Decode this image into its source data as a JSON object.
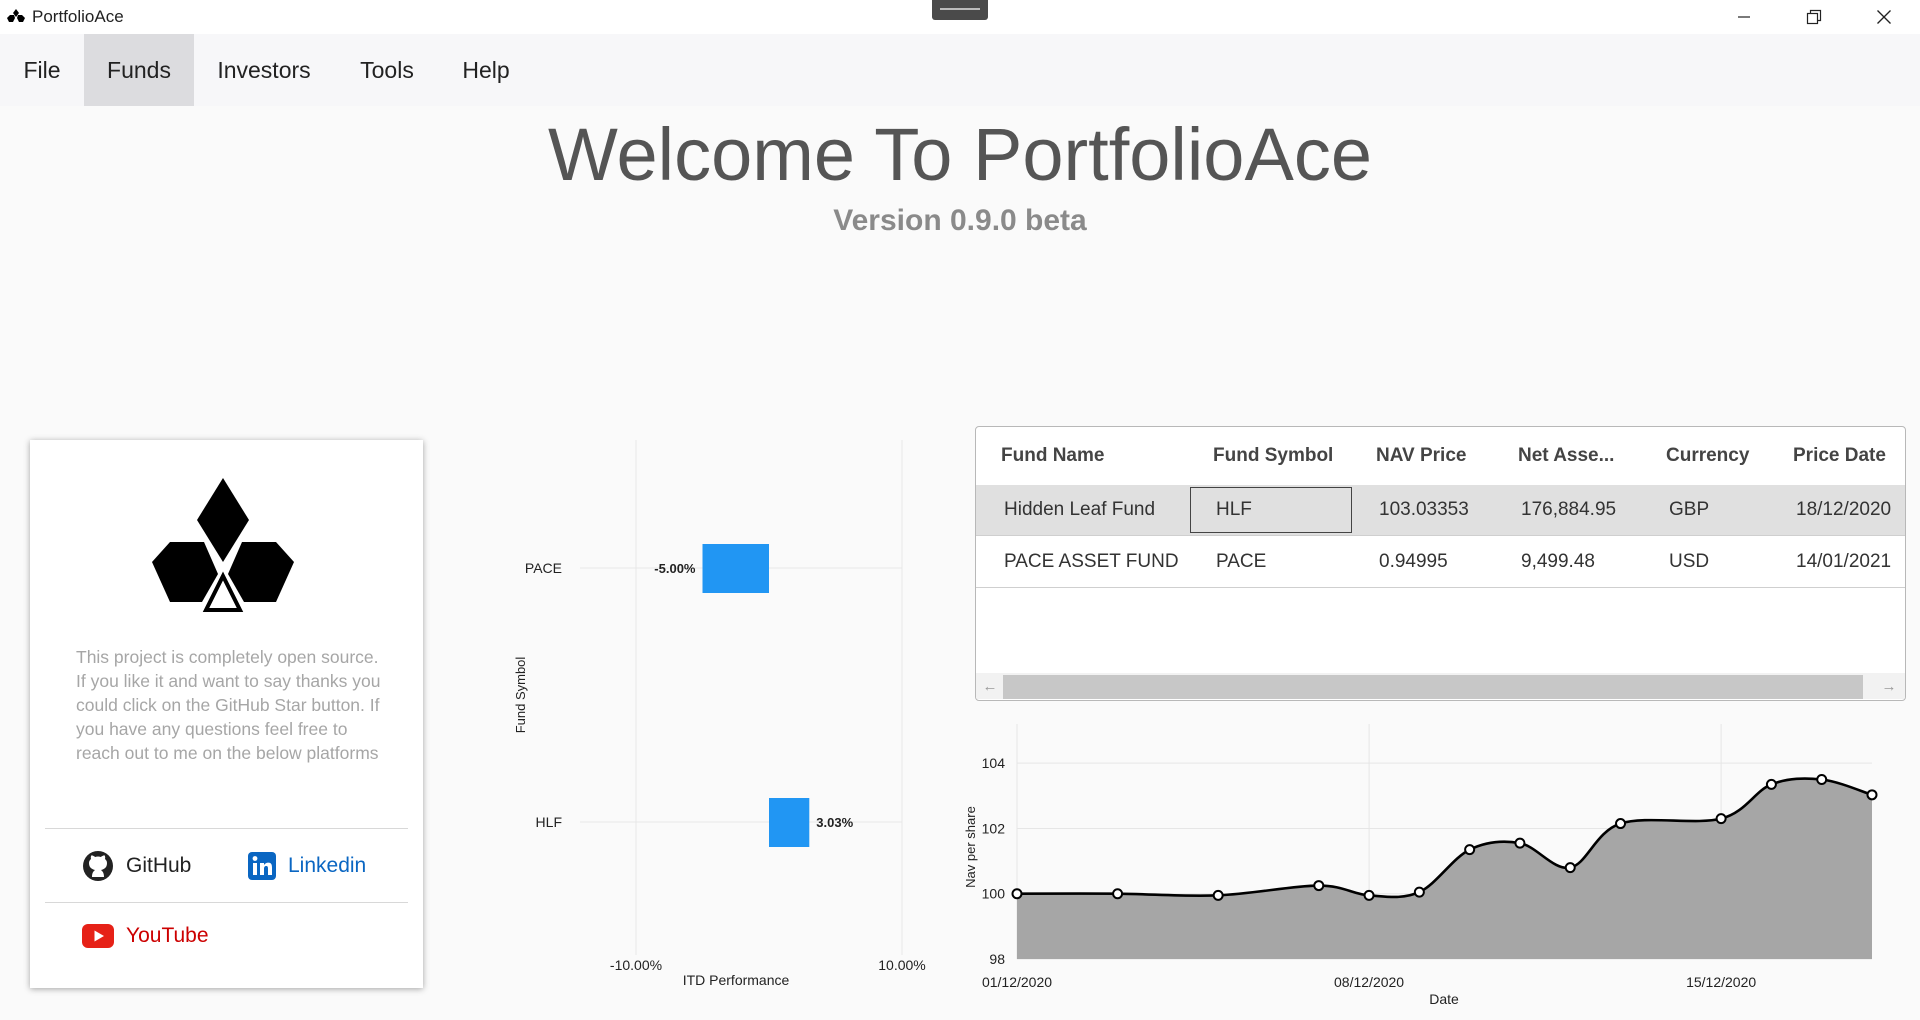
{
  "window": {
    "title": "PortfolioAce"
  },
  "menu": [
    {
      "label": "File",
      "active": false
    },
    {
      "label": "Funds",
      "active": true
    },
    {
      "label": "Investors",
      "active": false
    },
    {
      "label": "Tools",
      "active": false
    },
    {
      "label": "Help",
      "active": false
    }
  ],
  "welcome": {
    "title": "Welcome To PortfolioAce",
    "version": "Version 0.9.0 beta"
  },
  "card": {
    "description": "This project is completely open source. If you like it and want to say thanks you could click on the GitHub Star button. If you have any questions feel free to reach out to me on the below platforms",
    "github_label": "GitHub",
    "linkedin_label": "Linkedin",
    "youtube_label": "YouTube"
  },
  "table": {
    "columns": [
      "Fund Name",
      "Fund Symbol",
      "NAV Price",
      "Net Asse...",
      "Currency",
      "Price Date"
    ],
    "rows": [
      [
        "Hidden Leaf Fund",
        "HLF",
        "103.03353",
        "176,884.95",
        "GBP",
        "18/12/2020"
      ],
      [
        "PACE ASSET FUND",
        "PACE",
        "0.94995",
        "9,499.48",
        "USD",
        "14/01/2021"
      ]
    ],
    "selected_row": 0
  },
  "colors": {
    "bar": "#2196f3",
    "area": "#a6a6a6",
    "line": "#000000",
    "selected_row": "#e0e0e0",
    "linkedin": "#0a66c2",
    "youtube": "#e62117"
  },
  "chart_data": [
    {
      "type": "bar",
      "orientation": "horizontal",
      "categories": [
        "PACE",
        "HLF"
      ],
      "values": [
        -5.0,
        3.03
      ],
      "value_labels": [
        "-5.00%",
        "3.03%"
      ],
      "xlabel": "ITD Performance",
      "ylabel": "Fund Symbol",
      "xlim": [
        -10,
        10
      ],
      "tick_labels": [
        "-10.00%",
        "10.00%"
      ],
      "grid": true
    },
    {
      "type": "area",
      "x": [
        "01/12/2020",
        "03/12/2020",
        "05/12/2020",
        "07/12/2020",
        "08/12/2020",
        "09/12/2020",
        "10/12/2020",
        "11/12/2020",
        "12/12/2020",
        "13/12/2020",
        "15/12/2020",
        "16/12/2020",
        "17/12/2020",
        "18/12/2020"
      ],
      "values": [
        100.0,
        100.0,
        99.95,
        100.25,
        99.95,
        100.05,
        101.35,
        101.55,
        100.8,
        102.15,
        102.3,
        103.35,
        103.5,
        103.03
      ],
      "x_tick_labels": [
        "01/12/2020",
        "08/12/2020",
        "15/12/2020"
      ],
      "y_tick_labels": [
        "98",
        "100",
        "102",
        "104"
      ],
      "xlabel": "Date",
      "ylabel": "Nav per share",
      "ylim": [
        98,
        105.2
      ],
      "grid": true
    }
  ]
}
